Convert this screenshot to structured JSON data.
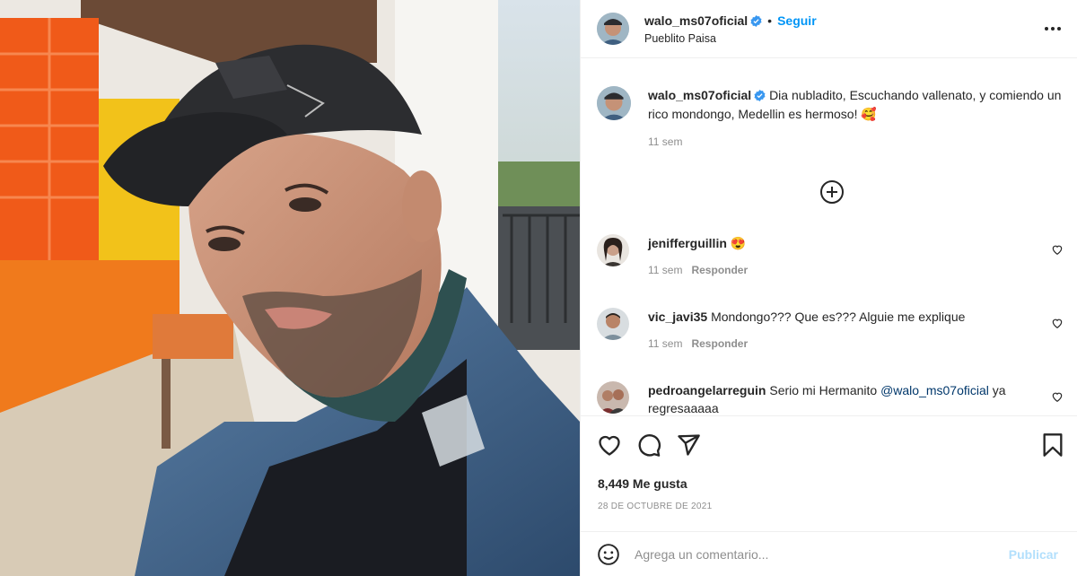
{
  "post": {
    "username": "walo_ms07oficial",
    "follow_label": "Seguir",
    "location": "Pueblito Paisa",
    "separator": "•"
  },
  "caption": {
    "username": "walo_ms07oficial",
    "text": "Dia nubladito, Escuchando vallenato, y comiendo un rico mondongo, Medellin es hermoso! 🥰",
    "time": "11 sem"
  },
  "comments": [
    {
      "username": "jeniffergui lin",
      "text": "😍",
      "time": "11 sem",
      "reply": "Responder"
    },
    {
      "username": "vic_javi35",
      "text": "Mondongo??? Que es??? Alguie me explique",
      "time": "11 sem",
      "reply": "Responder"
    },
    {
      "username": "pedroangelarreguin",
      "text_before": "Serio mi Hermanito ",
      "mention": "@walo_ms07oficial",
      "text_after": " ya regresaaaaa"
    }
  ],
  "stats": {
    "likes": "8,449 Me gusta",
    "date": "28 DE OCTUBRE DE 2021"
  },
  "composer": {
    "placeholder": "Agrega un comentario...",
    "publish_label": "Publicar"
  },
  "icons": {
    "like": "heart-icon",
    "comment": "comment-icon",
    "share": "share-icon",
    "save": "bookmark-icon",
    "more": "more-options-icon",
    "load_more": "plus-circle-icon",
    "emoji": "emoji-icon",
    "verified": "verified-badge-icon"
  },
  "colors": {
    "accent": "#0095f6",
    "verified": "#3897f0",
    "publish_disabled": "#b2dffc",
    "secondary_text": "#8e8e8e"
  }
}
